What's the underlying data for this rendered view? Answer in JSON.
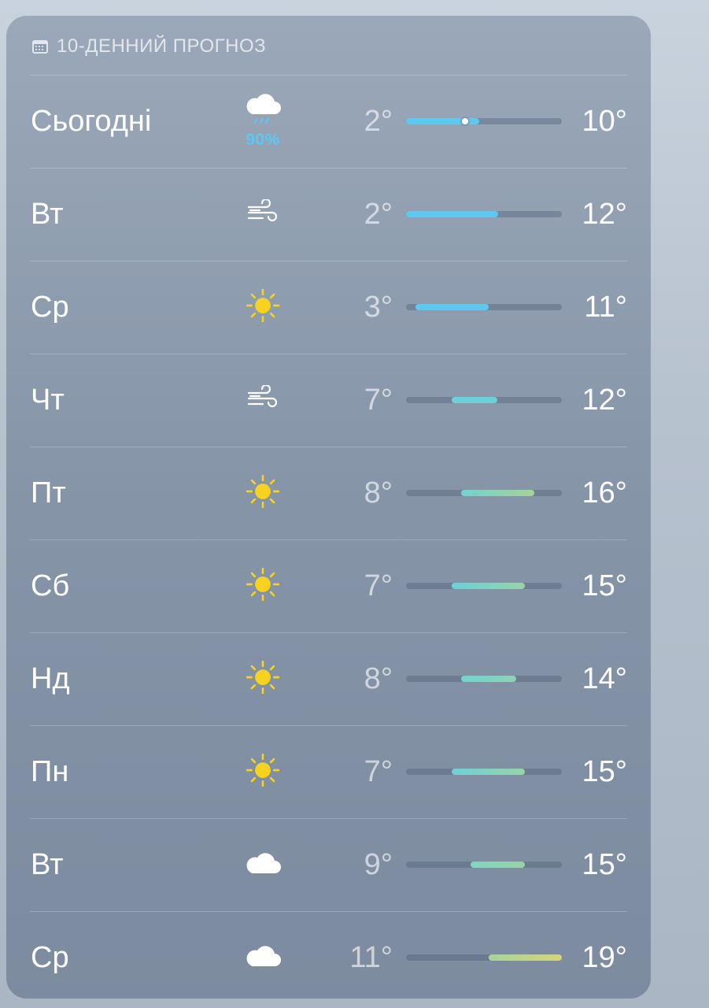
{
  "header": {
    "title": "10-ДЕННИЙ ПРОГНОЗ",
    "icon": "calendar-icon"
  },
  "scale": {
    "min": 2,
    "max": 19,
    "current": 6
  },
  "days": [
    {
      "day": "Сьогодні",
      "icon": "cloud-rain",
      "precip": "90%",
      "low": "2°",
      "high": "10°",
      "lowVal": 2,
      "highVal": 10,
      "showDot": true,
      "color1": "#5ec8ee",
      "color2": "#5ec8ee"
    },
    {
      "day": "Вт",
      "icon": "wind",
      "precip": "",
      "low": "2°",
      "high": "12°",
      "lowVal": 2,
      "highVal": 12,
      "showDot": false,
      "color1": "#5ec8ee",
      "color2": "#5ec8ee"
    },
    {
      "day": "Ср",
      "icon": "sun",
      "precip": "",
      "low": "3°",
      "high": "11°",
      "lowVal": 3,
      "highVal": 11,
      "showDot": false,
      "color1": "#5ec8ee",
      "color2": "#5ec8ee"
    },
    {
      "day": "Чт",
      "icon": "wind",
      "precip": "",
      "low": "7°",
      "high": "12°",
      "lowVal": 7,
      "highVal": 12,
      "showDot": false,
      "color1": "#6dd0d8",
      "color2": "#6dd0d8"
    },
    {
      "day": "Пт",
      "icon": "sun",
      "precip": "",
      "low": "8°",
      "high": "16°",
      "lowVal": 8,
      "highVal": 16,
      "showDot": false,
      "color1": "#72d3cf",
      "color2": "#a3d39a"
    },
    {
      "day": "Сб",
      "icon": "sun",
      "precip": "",
      "low": "7°",
      "high": "15°",
      "lowVal": 7,
      "highVal": 15,
      "showDot": false,
      "color1": "#6dd0d8",
      "color2": "#98d3a8"
    },
    {
      "day": "Нд",
      "icon": "sun",
      "precip": "",
      "low": "8°",
      "high": "14°",
      "lowVal": 8,
      "highVal": 14,
      "showDot": false,
      "color1": "#72d3cf",
      "color2": "#8ed3b4"
    },
    {
      "day": "Пн",
      "icon": "sun",
      "precip": "",
      "low": "7°",
      "high": "15°",
      "lowVal": 7,
      "highVal": 15,
      "showDot": false,
      "color1": "#6dd0d8",
      "color2": "#98d3a8"
    },
    {
      "day": "Вт",
      "icon": "cloud",
      "precip": "",
      "low": "9°",
      "high": "15°",
      "lowVal": 9,
      "highVal": 15,
      "showDot": false,
      "color1": "#80d3c2",
      "color2": "#98d3a8"
    },
    {
      "day": "Ср",
      "icon": "cloud",
      "precip": "",
      "low": "11°",
      "high": "19°",
      "lowVal": 11,
      "highVal": 19,
      "showDot": false,
      "color1": "#a5d49a",
      "color2": "#d6d27a"
    }
  ]
}
